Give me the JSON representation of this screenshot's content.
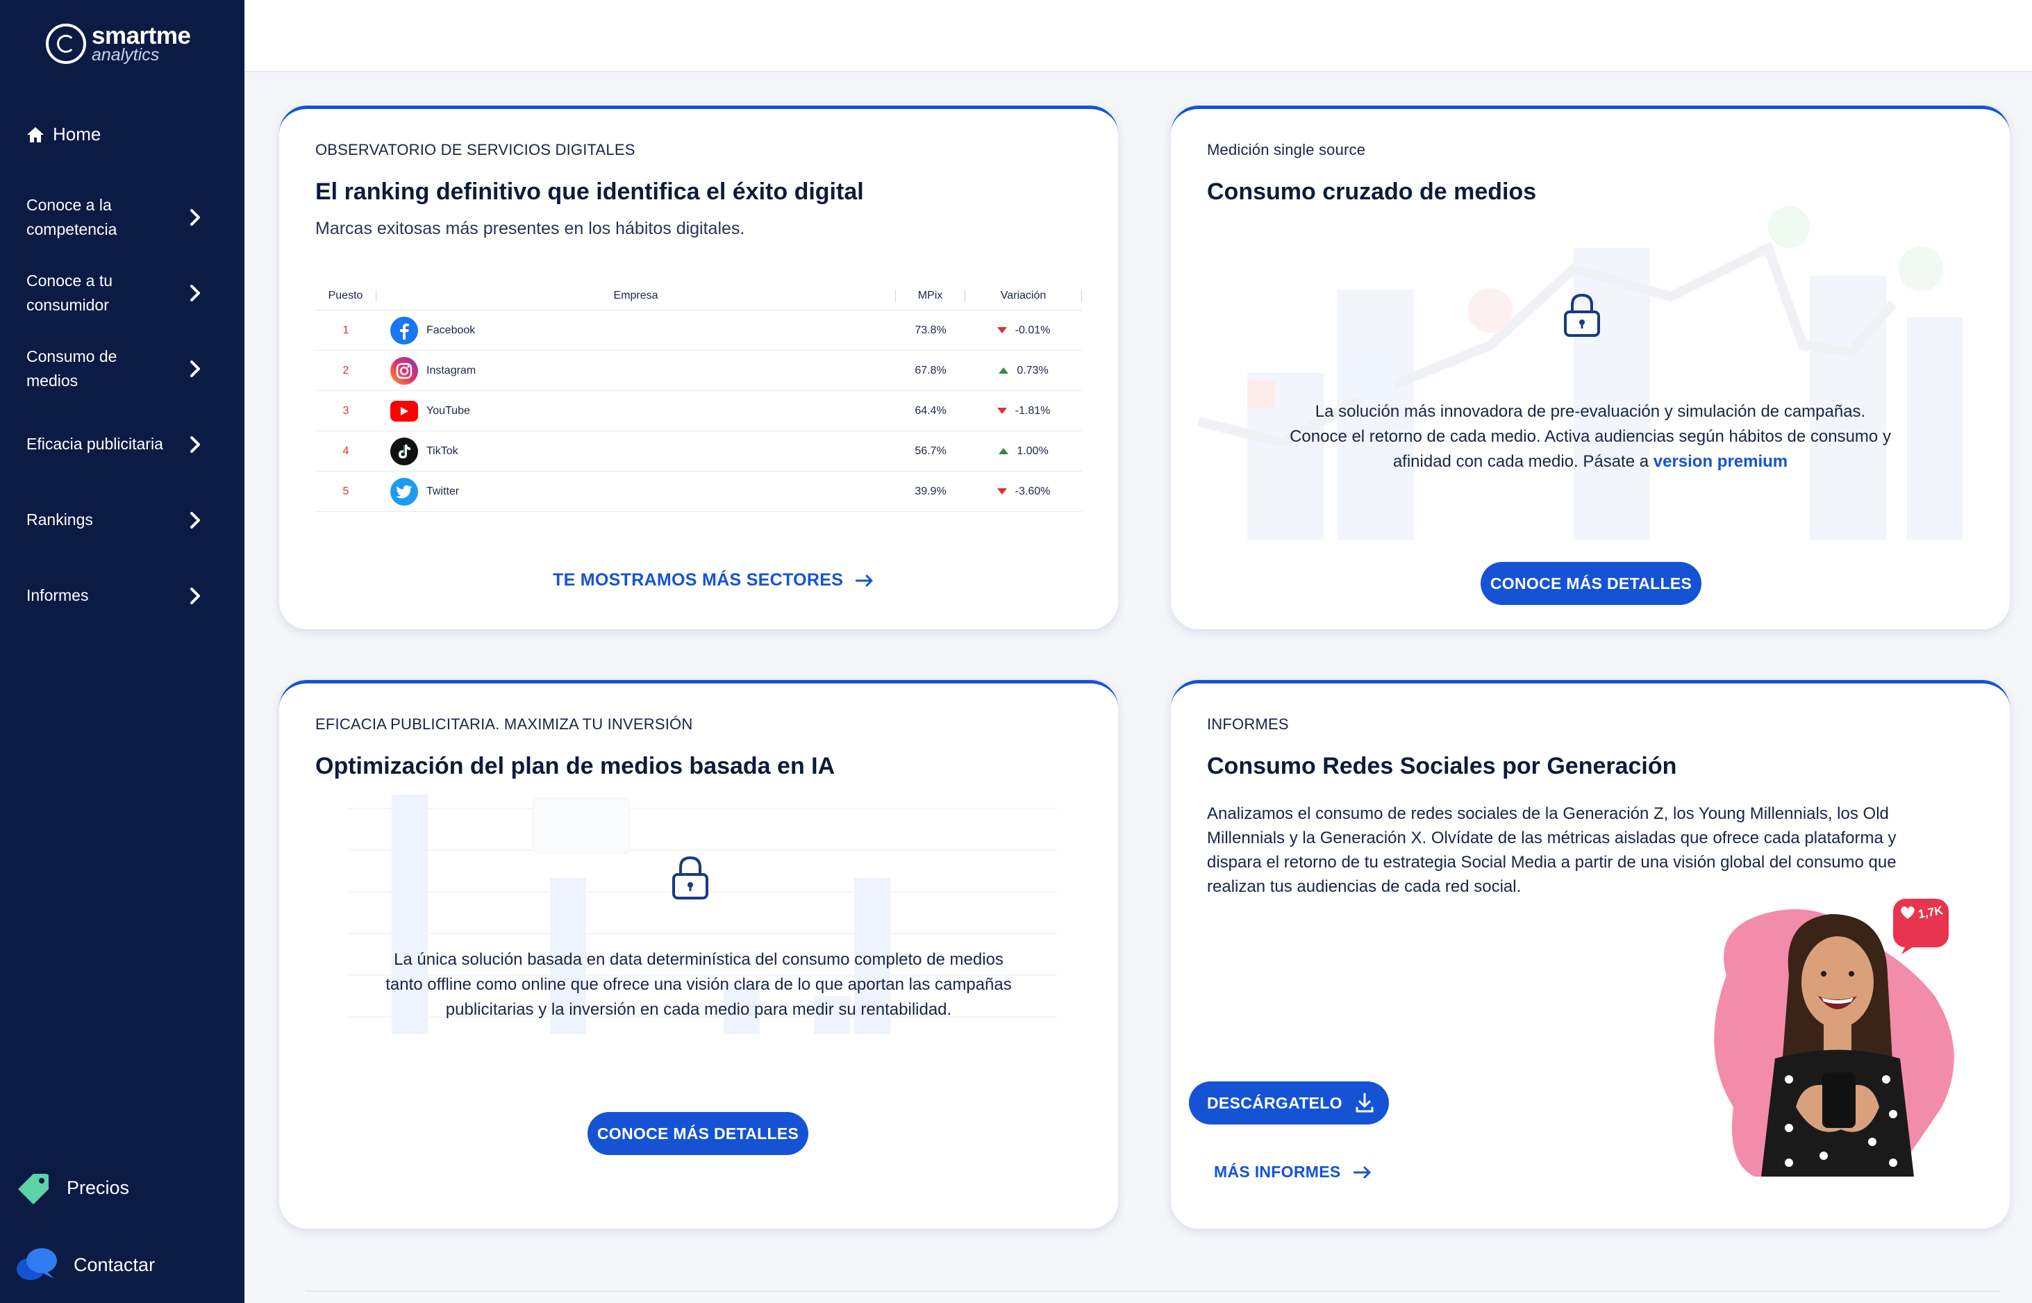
{
  "sidebar": {
    "logo": {
      "brand": "smartme",
      "sub": "analytics"
    },
    "home": "Home",
    "items": [
      {
        "label": "Conoce a la competencia"
      },
      {
        "label": "Conoce a tu consumidor"
      },
      {
        "label": "Consumo de medios"
      },
      {
        "label": "Eficacia publicitaria"
      },
      {
        "label": "Rankings"
      },
      {
        "label": "Informes"
      }
    ],
    "precios": "Precios",
    "contactar": "Contactar"
  },
  "card_ranking": {
    "eyebrow": "OBSERVATORIO DE SERVICIOS DIGITALES",
    "title": "El ranking definitivo que identifica el éxito digital",
    "subtitle": "Marcas exitosas más presentes en los hábitos digitales.",
    "table": {
      "headers": {
        "pos": "Puesto",
        "empresa": "Empresa",
        "mpix": "MPix",
        "variacion": "Variación"
      },
      "rows": [
        {
          "pos": "1",
          "name": "Facebook",
          "mpix": "73.8%",
          "var": "-0.01%",
          "trend": "down"
        },
        {
          "pos": "2",
          "name": "Instagram",
          "mpix": "67.8%",
          "var": "0.73%",
          "trend": "up"
        },
        {
          "pos": "3",
          "name": "YouTube",
          "mpix": "64.4%",
          "var": "-1.81%",
          "trend": "down"
        },
        {
          "pos": "4",
          "name": "TikTok",
          "mpix": "56.7%",
          "var": "1.00%",
          "trend": "up"
        },
        {
          "pos": "5",
          "name": "Twitter",
          "mpix": "39.9%",
          "var": "-3.60%",
          "trend": "down"
        }
      ]
    },
    "cta": "TE MOSTRAMOS MÁS SECTORES"
  },
  "card_medios": {
    "eyebrow": "Medición single source",
    "title": "Consumo cruzado de medios",
    "text_1": "La solución más innovadora de pre-evaluación y simulación de campañas.",
    "text_2": "Conoce el retorno de cada medio. Activa audiencias según hábitos de consumo y",
    "text_3": "afinidad con cada medio. Pásate a",
    "text_link": "version premium",
    "button": "CONOCE MÁS DETALLES"
  },
  "card_eficacia": {
    "eyebrow": "EFICACIA PUBLICITARIA. MAXIMIZA TU INVERSIÓN",
    "title": "Optimización del plan de medios basada en IA",
    "text": "La única solución basada en data determinística del consumo completo de medios tanto offline como online que ofrece una visión clara de lo que aportan las campañas publicitarias y la inversión en cada medio para medir su rentabilidad.",
    "button": "CONOCE MÁS DETALLES"
  },
  "card_informes": {
    "eyebrow": "INFORMES",
    "title": "Consumo Redes Sociales por Generación",
    "text": "Analizamos el consumo de redes sociales de la Generación Z, los Young Millennials, los Old Millennials y la Generación X. Olvídate de las métricas aisladas que ofrece cada plataforma y dispara el retorno de tu estrategia Social Media a partir de una visión global del consumo que realizan tus audiencias de cada red social.",
    "button": "DESCÁRGATELO",
    "cta": "MÁS INFORMES",
    "badge": "1,7K"
  },
  "colors": {
    "primary": "#1553d4",
    "sidebar": "#0c1b44",
    "down": "#d6342d",
    "up": "#2c8a3d"
  }
}
